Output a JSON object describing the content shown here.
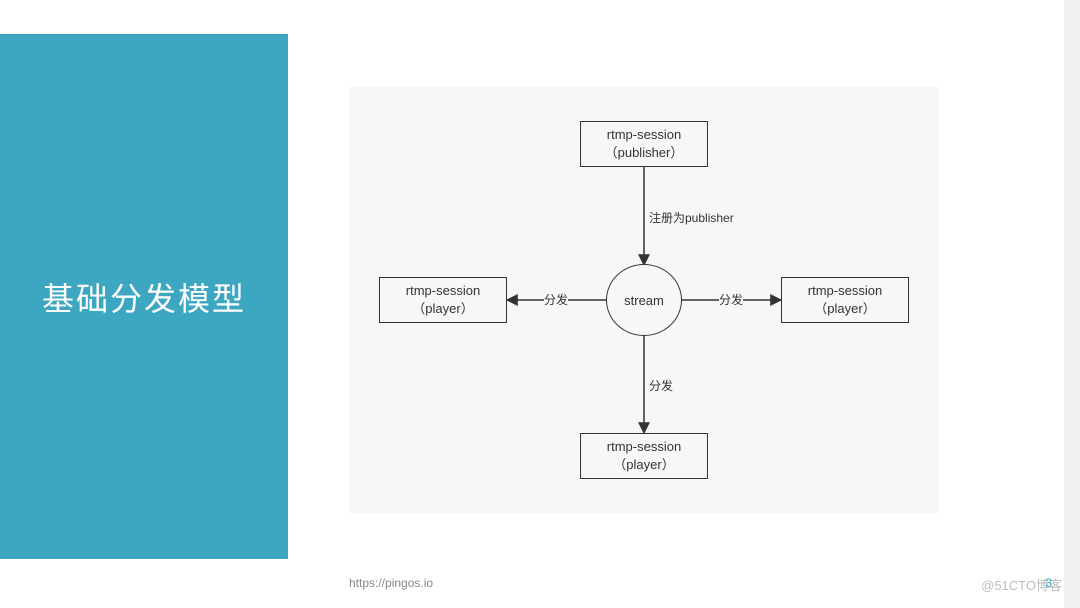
{
  "slide": {
    "title": "基础分发模型",
    "footer_url": "https://pingos.io",
    "watermark": "@51CTO博客",
    "page_number": "3"
  },
  "diagram": {
    "nodes": {
      "publisher": {
        "l1": "rtmp-session",
        "l2": "（publisher）"
      },
      "stream": {
        "label": "stream"
      },
      "player_l": {
        "l1": "rtmp-session",
        "l2": "（player）"
      },
      "player_r": {
        "l1": "rtmp-session",
        "l2": "（player）"
      },
      "player_b": {
        "l1": "rtmp-session",
        "l2": "（player）"
      }
    },
    "edges": {
      "pub_to_stream": "注册为publisher",
      "stream_to_left": "分发",
      "stream_to_right": "分发",
      "stream_to_bottom": "分发"
    }
  },
  "chart_data": {
    "type": "diagram",
    "title": "基础分发模型",
    "nodes": [
      {
        "id": "publisher",
        "label": "rtmp-session (publisher)",
        "shape": "rect"
      },
      {
        "id": "stream",
        "label": "stream",
        "shape": "circle"
      },
      {
        "id": "player_left",
        "label": "rtmp-session (player)",
        "shape": "rect"
      },
      {
        "id": "player_right",
        "label": "rtmp-session (player)",
        "shape": "rect"
      },
      {
        "id": "player_bottom",
        "label": "rtmp-session (player)",
        "shape": "rect"
      }
    ],
    "edges": [
      {
        "from": "publisher",
        "to": "stream",
        "label": "注册为publisher"
      },
      {
        "from": "stream",
        "to": "player_left",
        "label": "分发"
      },
      {
        "from": "stream",
        "to": "player_right",
        "label": "分发"
      },
      {
        "from": "stream",
        "to": "player_bottom",
        "label": "分发"
      }
    ]
  }
}
